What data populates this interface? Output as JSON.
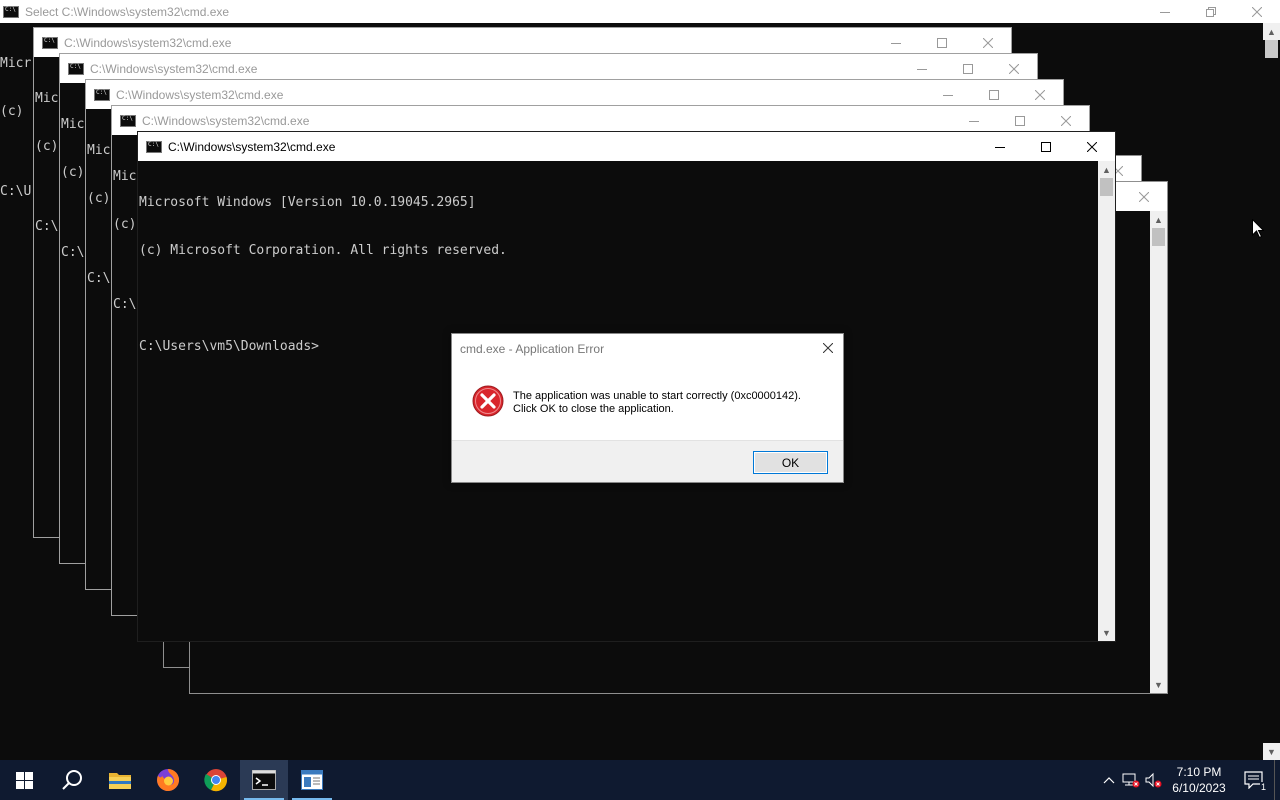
{
  "background_window": {
    "title": "Select C:\\Windows\\system32\\cmd.exe",
    "lines": [
      "Micr",
      "(c)",
      "",
      "C:\\U"
    ]
  },
  "stacked_windows": [
    {
      "title": "C:\\Windows\\system32\\cmd.exe",
      "lines": [
        "Mic",
        "(c)",
        "",
        "C:\\"
      ]
    },
    {
      "title": "C:\\Windows\\system32\\cmd.exe",
      "lines": [
        "Mic",
        "(c)",
        "",
        "C:\\"
      ]
    },
    {
      "title": "C:\\Windows\\system32\\cmd.exe",
      "lines": [
        "Mic",
        "(c)",
        "",
        "C:\\"
      ]
    },
    {
      "title": "C:\\Windows\\system32\\cmd.exe",
      "lines": [
        "Mic",
        "(c)",
        "",
        "C:\\"
      ]
    }
  ],
  "active_window": {
    "title": "C:\\Windows\\system32\\cmd.exe",
    "line1": "Microsoft Windows [Version 10.0.19045.2965]",
    "line2": "(c) Microsoft Corporation. All rights reserved.",
    "prompt": "C:\\Users\\vm5\\Downloads>"
  },
  "dialog": {
    "title": "cmd.exe - Application Error",
    "message_line1": "The application was unable to start correctly (0xc0000142).",
    "message_line2": "Click OK to close the application.",
    "ok_label": "OK",
    "icon": "error-icon"
  },
  "taskbar": {
    "items": [
      "start-icon",
      "search-icon",
      "file-explorer-icon",
      "firefox-icon",
      "chrome-icon",
      "cmd-icon",
      "app-window-icon"
    ],
    "time": "7:10 PM",
    "date": "6/10/2023",
    "notification_count": "1"
  },
  "colors": {
    "console_bg": "#0c0c0c",
    "console_fg": "#cccccc",
    "taskbar_bg": "#0f1a30",
    "error_red": "#d9262c",
    "ok_border": "#0078d7"
  }
}
